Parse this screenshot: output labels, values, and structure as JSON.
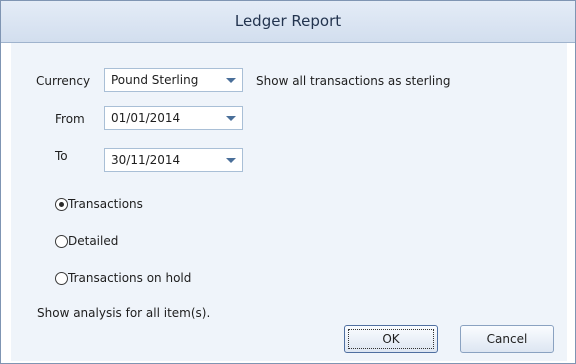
{
  "window": {
    "title": "Ledger Report"
  },
  "currency": {
    "label": "Currency",
    "selected": "Pound Sterling",
    "note": "Show all transactions as sterling"
  },
  "date_range": {
    "from_label": "From",
    "from_value": "01/01/2014",
    "to_label": "To",
    "to_value": "30/11/2014"
  },
  "report_type": {
    "options": [
      {
        "label": "Transactions",
        "selected": true
      },
      {
        "label": "Detailed",
        "selected": false
      },
      {
        "label": "Transactions on hold",
        "selected": false
      }
    ]
  },
  "analysis_note": "Show analysis for all item(s).",
  "buttons": {
    "ok": "OK",
    "cancel": "Cancel"
  }
}
